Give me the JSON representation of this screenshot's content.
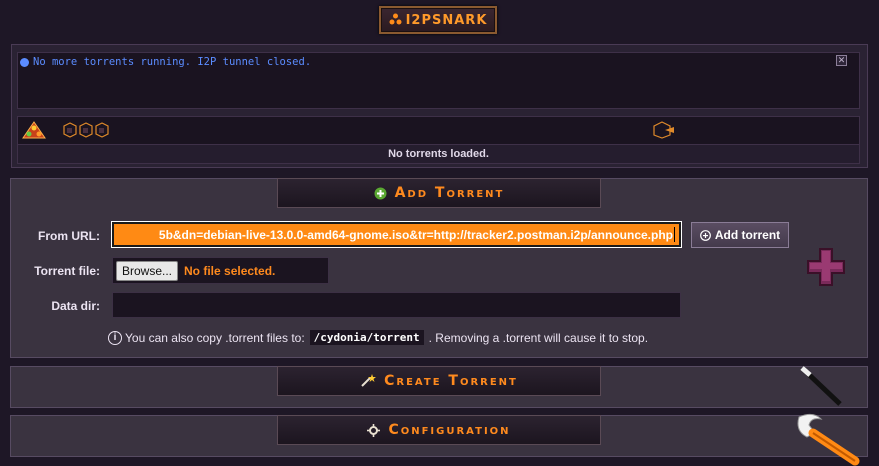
{
  "header": {
    "logo_label": "I2PSNARK"
  },
  "status": {
    "message": "No more torrents running. I2P tunnel closed.",
    "close_symbol": "✕"
  },
  "torrents": {
    "empty_message": "No torrents loaded."
  },
  "add_torrent": {
    "title": "Add Torrent",
    "from_url_label": "From URL:",
    "from_url_value": "5b&dn=debian-live-13.0.0-amd64-gnome.iso&tr=http://tracker2.postman.i2p/announce.php",
    "add_button_label": "Add torrent",
    "torrent_file_label": "Torrent file:",
    "browse_label": "Browse...",
    "no_file_label": "No file selected.",
    "data_dir_label": "Data dir:",
    "data_dir_value": "",
    "hint_prefix": "You can also copy .torrent files to:",
    "hint_path": "/cydonia/torrent",
    "hint_suffix": ". Removing a .torrent will cause it to stop."
  },
  "create_torrent": {
    "title": "Create Torrent"
  },
  "configuration": {
    "title": "Configuration"
  },
  "colors": {
    "accent": "#ff8a1e",
    "status_text": "#5b8cff",
    "background": "#1e1726",
    "panel": "#3a3340"
  },
  "icons": {
    "logo": "snark-triangle-icon",
    "status": "info-dot-icon",
    "filter_all": "torrent-all-icon",
    "filter_states": "torrent-states-icon",
    "filter_single": "torrent-single-icon",
    "add": "plus-circle-icon",
    "create": "wand-icon",
    "config": "gear-icon",
    "add_large": "large-plus-icon",
    "create_decor": "magic-wand-icon",
    "config_decor": "wrench-icon"
  }
}
